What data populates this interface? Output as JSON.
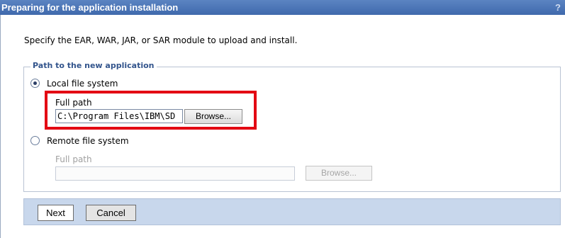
{
  "window": {
    "title": "Preparing for the application installation",
    "help": "?"
  },
  "intro": "Specify the EAR, WAR, JAR, or SAR module to upload and install.",
  "group": {
    "legend": "Path to the new application"
  },
  "local": {
    "label": "Local file system",
    "selected": true,
    "field_label": "Full path",
    "value": "C:\\Program Files\\IBM\\SD",
    "browse": "Browse..."
  },
  "remote": {
    "label": "Remote file system",
    "selected": false,
    "field_label": "Full path",
    "value": "",
    "browse": "Browse..."
  },
  "buttons": {
    "next": "Next",
    "cancel": "Cancel"
  },
  "colors": {
    "titlebar": "#4a74b7",
    "highlight": "#e30613",
    "buttonbar": "#c8d7ec",
    "legend": "#32548c"
  }
}
